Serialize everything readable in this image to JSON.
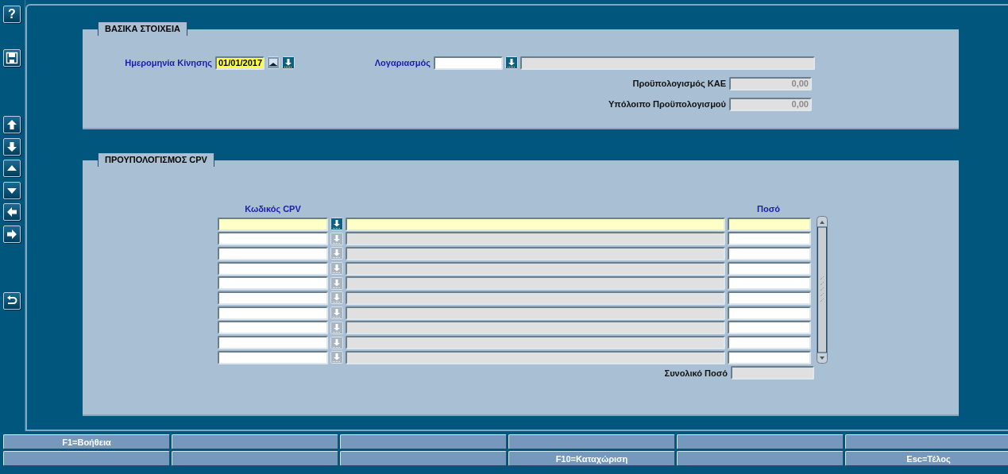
{
  "toolbar": [
    {
      "kind": "help",
      "glyph": "?"
    },
    {
      "kind": "save"
    },
    {
      "kind": "record-up"
    },
    {
      "kind": "record-down"
    },
    {
      "kind": "page-up"
    },
    {
      "kind": "page-down"
    },
    {
      "kind": "left"
    },
    {
      "kind": "right"
    },
    {
      "kind": "undo"
    }
  ],
  "basic": {
    "title": "ΒΑΣΙΚΑ ΣΤΟΙΧΕΙΑ",
    "date_label": "Ημερομηνία Κίνησης",
    "date_value": "01/01/2017",
    "account_label": "Λογαριασμός",
    "budget_label": "Προϋπολογισμός ΚΑΕ",
    "budget_value": "0,00",
    "remaining_label": "Υπόλοιπο Προϋπολογισμού",
    "remaining_value": "0,00"
  },
  "cpv": {
    "title": "ΠΡΟΥΠΟΛΟΓΙΣΜΟΣ CPV",
    "columns": [
      "Κωδικός CPV",
      "Ποσό"
    ],
    "total_label": "Συνολικό Ποσό",
    "rows": [
      {
        "selected": true
      },
      {
        "selected": false
      },
      {
        "selected": false
      },
      {
        "selected": false
      },
      {
        "selected": false
      },
      {
        "selected": false
      },
      {
        "selected": false
      },
      {
        "selected": false
      },
      {
        "selected": false
      },
      {
        "selected": false
      }
    ]
  },
  "function_keys": [
    [
      {
        "kind": "key",
        "label": "F1=Βοήθεια"
      },
      {
        "kind": "blank"
      },
      {
        "kind": "blank"
      },
      {
        "kind": "blank"
      },
      {
        "kind": "blank"
      },
      {
        "kind": "blank"
      }
    ],
    [
      {
        "kind": "blank"
      },
      {
        "kind": "blank"
      },
      {
        "kind": "blank"
      },
      {
        "kind": "key",
        "label": "F10=Καταχώριση"
      },
      {
        "kind": "blank"
      },
      {
        "kind": "key",
        "label": "Esc=Τέλος"
      }
    ]
  ]
}
